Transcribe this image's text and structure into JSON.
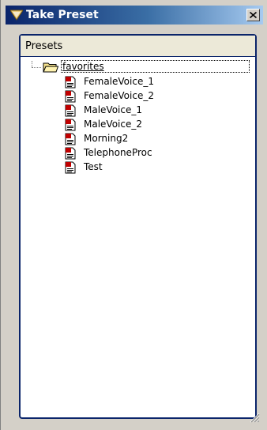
{
  "window": {
    "title": "Take Preset"
  },
  "panel": {
    "header": "Presets"
  },
  "tree": {
    "folder": {
      "label": "favorites",
      "icon": "open-folder-icon",
      "children": [
        {
          "label": "FemaleVoice_1",
          "icon": "preset-document-icon"
        },
        {
          "label": "FemaleVoice_2",
          "icon": "preset-document-icon"
        },
        {
          "label": "MaleVoice_1",
          "icon": "preset-document-icon"
        },
        {
          "label": "MaleVoice_2",
          "icon": "preset-document-icon"
        },
        {
          "label": "Morning2",
          "icon": "preset-document-icon"
        },
        {
          "label": "TelephoneProc",
          "icon": "preset-document-icon"
        },
        {
          "label": "Test",
          "icon": "preset-document-icon"
        }
      ]
    }
  },
  "colors": {
    "titlebar_start": "#0a246a",
    "titlebar_end": "#a6caf0",
    "panel_border": "#0a246a",
    "panel_header_bg": "#ece9d8",
    "preset_icon_red": "#c00000"
  }
}
